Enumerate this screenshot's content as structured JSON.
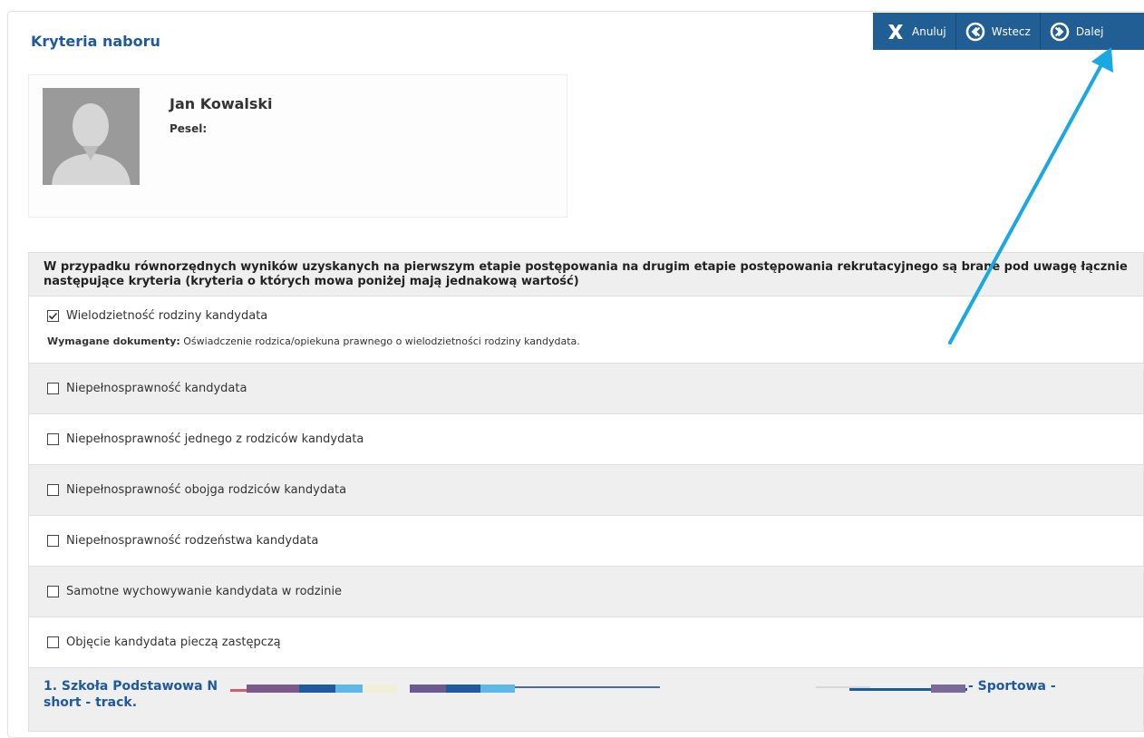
{
  "page": {
    "title": "Kryteria naboru"
  },
  "toolbar": {
    "cancel_label": "Anuluj",
    "back_label": "Wstecz",
    "next_label": "Dalej"
  },
  "profile": {
    "name": "Jan Kowalski",
    "pesel_label": "Pesel:"
  },
  "criteria": {
    "header": "W przypadku równorzędnych wyników uzyskanych na pierwszym etapie postępowania na drugim etapie postępowania rekrutacyjnego są brane pod uwagę łącznie następujące kryteria (kryteria o których mowa poniżej mają jednakową wartość)",
    "items": [
      {
        "label": "Wielodzietność rodziny kandydata",
        "checked": true
      },
      {
        "label": "Niepełnosprawność kandydata",
        "checked": false
      },
      {
        "label": "Niepełnosprawność jednego z rodziców kandydata",
        "checked": false
      },
      {
        "label": "Niepełnosprawność obojga rodziców kandydata",
        "checked": false
      },
      {
        "label": "Niepełnosprawność rodzeństwa kandydata",
        "checked": false
      },
      {
        "label": "Samotne wychowywanie kandydata w rodzinie",
        "checked": false
      },
      {
        "label": "Objęcie kandydata pieczą zastępczą",
        "checked": false
      }
    ],
    "required_docs_label": "Wymagane dokumenty:",
    "required_docs_text": "Oświadczenie rodzica/opiekuna prawnego o wielodzietności rodziny kandydata."
  },
  "school": {
    "prefix": "1. Szkoła Podstawowa N",
    "suffix": "- Sportowa -",
    "line2": "short - track."
  },
  "colors": {
    "accent": "#1f5aa0",
    "toolbar_bg": "#215e93",
    "annotation_arrow": "#1aa8e0"
  }
}
